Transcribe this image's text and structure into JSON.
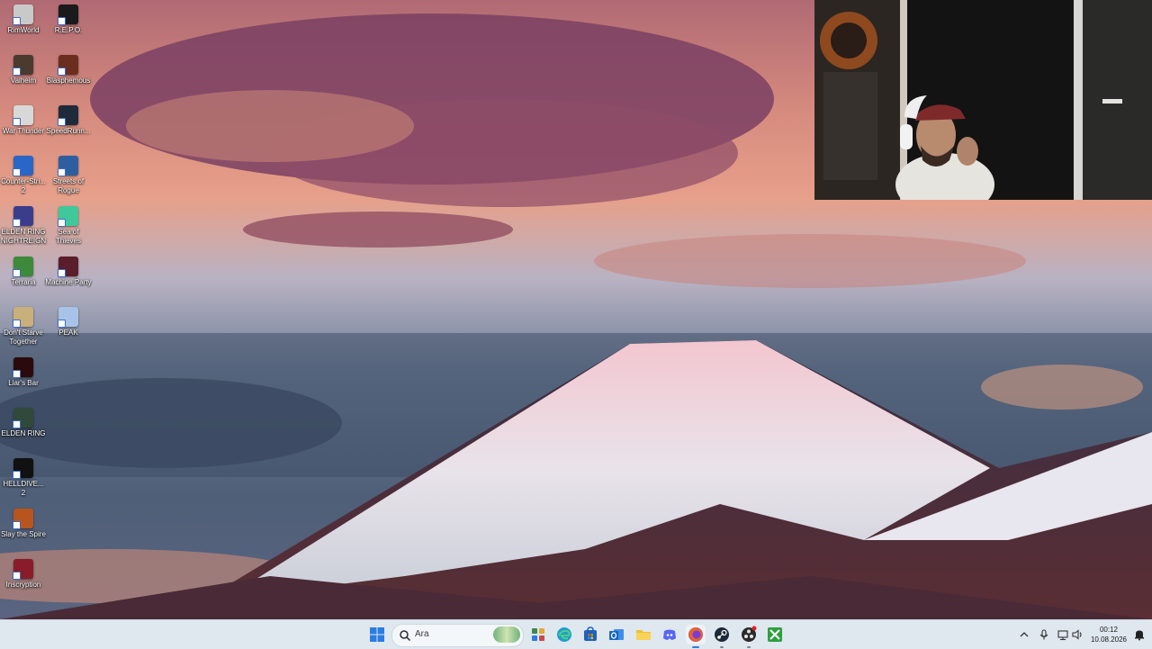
{
  "desktop": {
    "icons": [
      {
        "label": "RimWorld",
        "icon": "rimworld-icon",
        "color": "#c9c9c9"
      },
      {
        "label": "R.E.P.O.",
        "icon": "repo-icon",
        "color": "#1a1a1a"
      },
      {
        "label": "Valheim",
        "icon": "valheim-icon",
        "color": "#4b3a2e"
      },
      {
        "label": "Blasphemous",
        "icon": "blasphemous-icon",
        "color": "#6a2e1e"
      },
      {
        "label": "War Thunder",
        "icon": "war-thunder-icon",
        "color": "#d8d8d8"
      },
      {
        "label": "SpeedRunn...",
        "icon": "speedrunners-icon",
        "color": "#1e2a3a"
      },
      {
        "label": "Counter-Stri... 2",
        "icon": "counter-strike-icon",
        "color": "#2a66c8"
      },
      {
        "label": "Streets of Rogue",
        "icon": "streets-of-rogue-icon",
        "color": "#2d5fa0"
      },
      {
        "label": "ELDEN RING NIGHTREIGN",
        "icon": "elden-ring-nightreign-icon",
        "color": "#3b3c8c"
      },
      {
        "label": "Sea of Thieves",
        "icon": "sea-of-thieves-icon",
        "color": "#3fc99a"
      },
      {
        "label": "Terraria",
        "icon": "terraria-icon",
        "color": "#3c8a3a"
      },
      {
        "label": "Machine Party",
        "icon": "machine-party-icon",
        "color": "#5a1d2a"
      },
      {
        "label": "Don't Starve Together",
        "icon": "dont-starve-icon",
        "color": "#c9b07a"
      },
      {
        "label": "PEAK",
        "icon": "peak-icon",
        "color": "#a7c4e8"
      },
      {
        "label": "Liar's Bar",
        "icon": "liars-bar-icon",
        "color": "#2a0a0a"
      },
      {
        "label": "ELDEN RING",
        "icon": "elden-ring-icon",
        "color": "#2f4a3a"
      },
      {
        "label": "HELLDIVE... 2",
        "icon": "helldivers-icon",
        "color": "#111111"
      },
      {
        "label": "Slay the Spire",
        "icon": "slay-the-spire-icon",
        "color": "#b8551e"
      },
      {
        "label": "Inscryption",
        "icon": "inscryption-icon",
        "color": "#8a1c2a"
      }
    ]
  },
  "taskbar": {
    "search_placeholder": "Ara",
    "apps": [
      {
        "name": "start-button",
        "icon": "windows-logo-icon",
        "color": "#2a7de1"
      },
      {
        "name": "widgets-button",
        "icon": "widgets-icon",
        "color": "#3d8a4a"
      },
      {
        "name": "edge-button",
        "icon": "edge-icon",
        "color": "#1f9bd6"
      },
      {
        "name": "store-button",
        "icon": "store-icon",
        "color": "#1f5fbf"
      },
      {
        "name": "outlook-button",
        "icon": "outlook-icon",
        "color": "#1565c0"
      },
      {
        "name": "file-explorer-button",
        "icon": "folder-icon",
        "color": "#f2c12e"
      },
      {
        "name": "discord-button",
        "icon": "discord-icon",
        "color": "#5865f2"
      },
      {
        "name": "firefox-button",
        "icon": "firefox-icon",
        "color": "#e8632a"
      },
      {
        "name": "steam-button",
        "icon": "steam-icon",
        "color": "#1b2838"
      },
      {
        "name": "obs-button",
        "icon": "obs-icon",
        "color": "#2b2b2b"
      },
      {
        "name": "xbox-button",
        "icon": "xbox-icon",
        "color": "#2f9e3f"
      }
    ],
    "tray": {
      "time": "00:12",
      "date": "10.08.2026"
    }
  }
}
